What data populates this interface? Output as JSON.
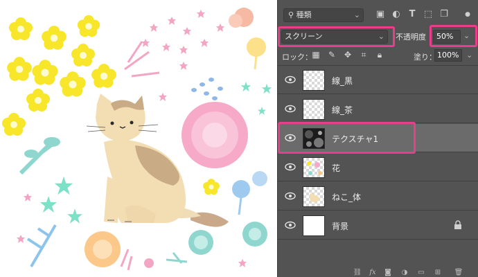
{
  "panel": {
    "filter": {
      "label": "種類",
      "icons": [
        "image-icon",
        "adjustment-icon",
        "type-icon",
        "shape-icon",
        "smart-object-icon"
      ]
    },
    "blend_mode": "スクリーン",
    "opacity_label": "不透明度",
    "opacity_value": "50%",
    "lock_label": "ロック：",
    "fill_label": "塗り：",
    "fill_value": "100%",
    "layers": [
      {
        "name": "線_黒",
        "thumbnail": "transparent",
        "visible": true,
        "selected": false,
        "locked": false
      },
      {
        "name": "線_茶",
        "thumbnail": "transparent",
        "visible": true,
        "selected": false,
        "locked": false
      },
      {
        "name": "テクスチャ1",
        "thumbnail": "texture",
        "visible": true,
        "selected": true,
        "locked": false
      },
      {
        "name": "花",
        "thumbnail": "flowers",
        "visible": true,
        "selected": false,
        "locked": false
      },
      {
        "name": "ねこ_体",
        "thumbnail": "cat",
        "visible": true,
        "selected": false,
        "locked": false
      },
      {
        "name": "背景",
        "thumbnail": "white",
        "visible": true,
        "selected": false,
        "locked": true
      }
    ],
    "footer_icons": [
      "link-icon",
      "fx-icon",
      "mask-icon",
      "adjustment-layer-icon",
      "group-folder-icon",
      "new-layer-icon",
      "trash-icon"
    ]
  },
  "colors": {
    "panel_bg": "#535353",
    "selected_layer_bg": "#6b6b6b",
    "highlight": "#e83e8c"
  }
}
